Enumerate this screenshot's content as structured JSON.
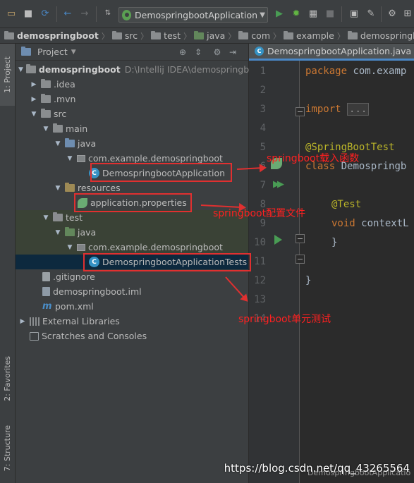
{
  "toolbar": {
    "run_config": "DemospringbootApplication",
    "icons": [
      "folder-open-icon",
      "save-icon",
      "sync-icon",
      "back-icon",
      "forward-icon",
      "build-icon",
      "run-config-icon",
      "dropdown-icon",
      "run-icon",
      "debug-icon",
      "coverage-icon",
      "stop-icon",
      "sdk-icon",
      "settings-icon",
      "structure-icon"
    ]
  },
  "breadcrumb": [
    "demospringboot",
    "src",
    "test",
    "java",
    "com",
    "example",
    "demospringboot"
  ],
  "left_stripe": {
    "project": "1: Project",
    "favorites": "2: Favorites",
    "structure": "7: Structure"
  },
  "project_panel": {
    "title": "Project",
    "tree": [
      {
        "label": "demospringboot",
        "path": "D:\\Intellij IDEA\\demospringboc"
      },
      {
        "label": ".idea"
      },
      {
        "label": ".mvn"
      },
      {
        "label": "src"
      },
      {
        "label": "main"
      },
      {
        "label": "java"
      },
      {
        "label": "com.example.demospringboot"
      },
      {
        "label": "DemospringbootApplication"
      },
      {
        "label": "resources"
      },
      {
        "label": "application.properties"
      },
      {
        "label": "test"
      },
      {
        "label": "java"
      },
      {
        "label": "com.example.demospringboot"
      },
      {
        "label": "DemospringbootApplicationTests"
      },
      {
        "label": ".gitignore"
      },
      {
        "label": "demospringboot.iml"
      },
      {
        "label": "pom.xml"
      },
      {
        "label": "External Libraries"
      },
      {
        "label": "Scratches and Consoles"
      }
    ]
  },
  "editor": {
    "tab": "DemospringbootApplication.java",
    "line_numbers": [
      "1",
      "2",
      "3",
      "4",
      "5",
      "6",
      "7",
      "8",
      "9",
      "10",
      "11",
      "12",
      "13",
      "14"
    ],
    "code": {
      "l1_kw": "package",
      "l1_rest": " com.examp",
      "l3_kw": "import",
      "l3_fold": "...",
      "l6": "@SpringBootTest",
      "l7_kw": "class",
      "l7_rest": " Demospringb",
      "l9": "@Test",
      "l10_kw": "void",
      "l10_rest": " contextL",
      "l11": "}",
      "l13": "}"
    }
  },
  "annotations": {
    "main_class": "springboot载入函数",
    "properties": "springboot配置文件",
    "tests": "springboot单元测试",
    "color": "#e03030"
  },
  "watermark": "https://blog.csdn.net/qq_43265564",
  "status_hint": "DemospringbootApplicatio"
}
